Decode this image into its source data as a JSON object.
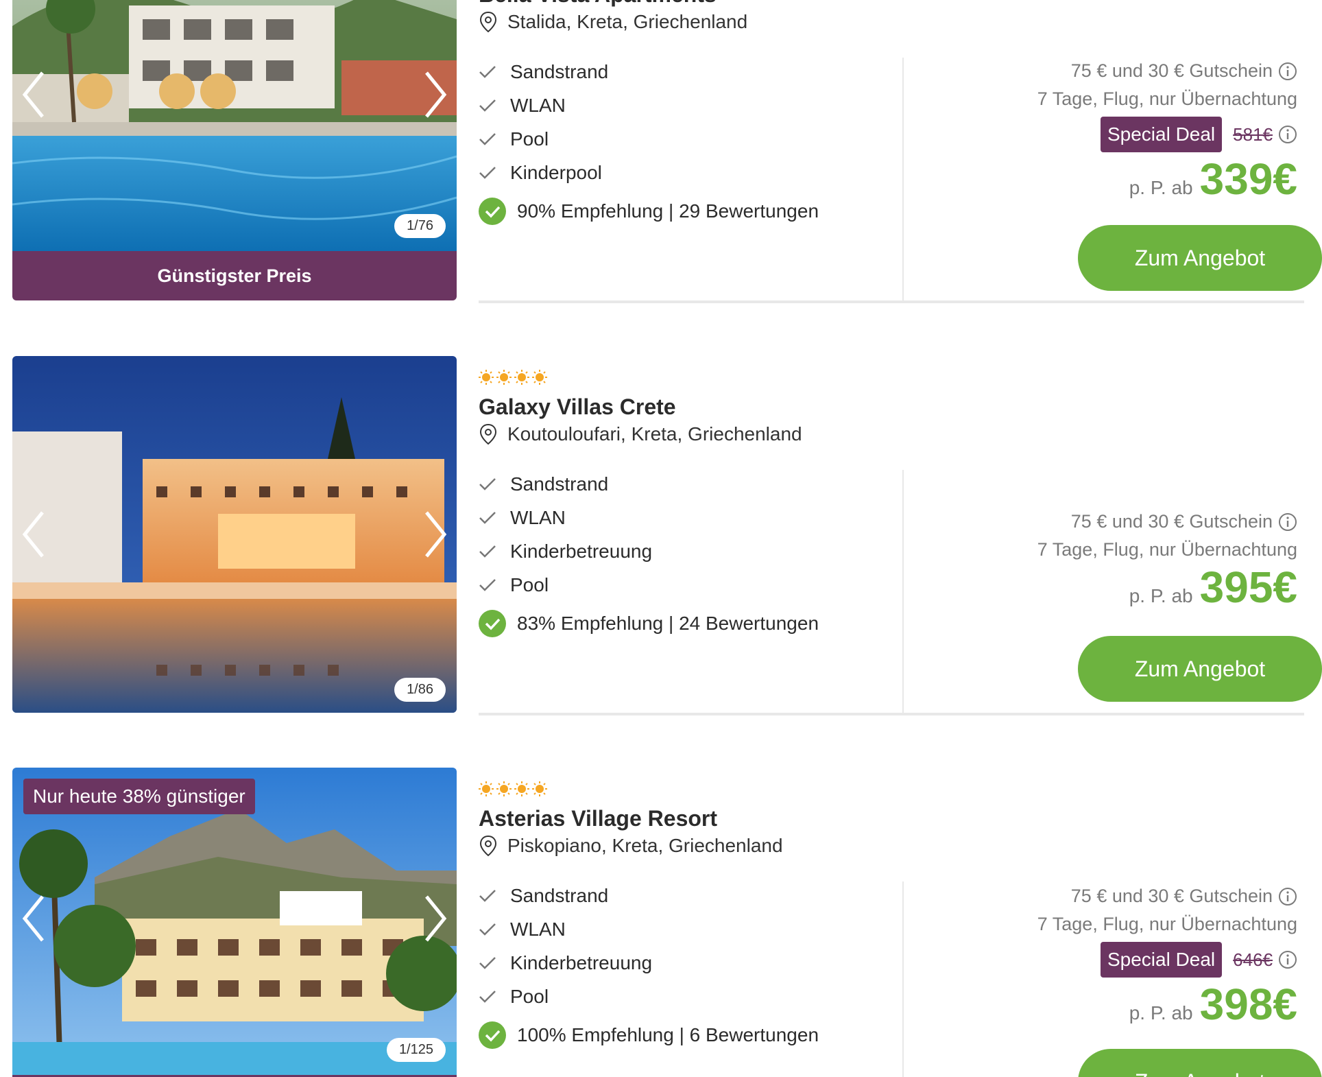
{
  "colors": {
    "accent_green": "#6db33f",
    "brand_purple": "#6b3561",
    "star_orange": "#f5a623"
  },
  "hotels": [
    {
      "name": "Bella Vista Apartments",
      "stars": 0,
      "location": "Stalida, Kreta, Griechenland",
      "photo_counter": "1/76",
      "banner": "Günstigster Preis",
      "discount_badge": "",
      "features": [
        "Sandstrand",
        "WLAN",
        "Pool",
        "Kinderpool"
      ],
      "rating": "90% Empfehlung | 29 Bewertungen",
      "voucher": "75 € und 30 € Gutschein",
      "duration": "7 Tage, Flug, nur Übernachtung",
      "special_deal": "Special Deal",
      "old_price": "581€",
      "price_prefix": "p. P. ab",
      "price": "339€",
      "cta": "Zum Angebot"
    },
    {
      "name": "Galaxy Villas Crete",
      "stars": 4,
      "location": "Koutouloufari, Kreta, Griechenland",
      "photo_counter": "1/86",
      "banner": "",
      "discount_badge": "",
      "features": [
        "Sandstrand",
        "WLAN",
        "Kinderbetreuung",
        "Pool"
      ],
      "rating": "83% Empfehlung | 24 Bewertungen",
      "voucher": "75 € und 30 € Gutschein",
      "duration": "7 Tage, Flug, nur Übernachtung",
      "special_deal": "",
      "old_price": "",
      "price_prefix": "p. P. ab",
      "price": "395€",
      "cta": "Zum Angebot"
    },
    {
      "name": "Asterias Village Resort",
      "stars": 4,
      "location": "Piskopiano, Kreta, Griechenland",
      "photo_counter": "1/125",
      "banner": "",
      "discount_badge": "Nur heute 38% günstiger",
      "features": [
        "Sandstrand",
        "WLAN",
        "Kinderbetreuung",
        "Pool"
      ],
      "rating": "100% Empfehlung | 6 Bewertungen",
      "voucher": "75 € und 30 € Gutschein",
      "duration": "7 Tage, Flug, nur Übernachtung",
      "special_deal": "Special Deal",
      "old_price": "646€",
      "price_prefix": "p. P. ab",
      "price": "398€",
      "cta": "Zum Angebot"
    }
  ]
}
